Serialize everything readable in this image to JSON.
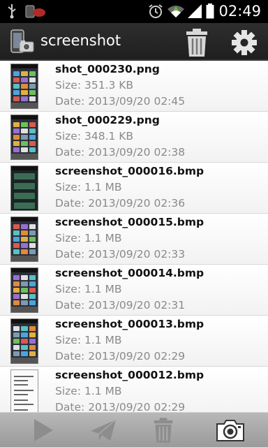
{
  "status_bar": {
    "time": "02:49",
    "icons": [
      "usb-icon",
      "app-notification-icon",
      "alarm-icon",
      "wifi-icon",
      "signal-icon",
      "battery-icon"
    ]
  },
  "action_bar": {
    "title": "screenshot",
    "icons": [
      "app-icon",
      "trash-icon",
      "gear-icon"
    ]
  },
  "files": [
    {
      "name": "shot_000230.png",
      "size": "Size: 351.3 KB",
      "date": "Date: 2013/09/20 02:45",
      "thumb": "home"
    },
    {
      "name": "shot_000229.png",
      "size": "Size: 348.1 KB",
      "date": "Date: 2013/09/20 02:38",
      "thumb": "home"
    },
    {
      "name": "screenshot_000016.bmp",
      "size": "Size: 1.1 MB",
      "date": "Date: 2013/09/20 02:36",
      "thumb": "dark"
    },
    {
      "name": "screenshot_000015.bmp",
      "size": "Size: 1.1 MB",
      "date": "Date: 2013/09/20 02:33",
      "thumb": "home"
    },
    {
      "name": "screenshot_000014.bmp",
      "size": "Size: 1.1 MB",
      "date": "Date: 2013/09/20 02:31",
      "thumb": "home"
    },
    {
      "name": "screenshot_000013.bmp",
      "size": "Size: 1.1 MB",
      "date": "Date: 2013/09/20 02:29",
      "thumb": "home"
    },
    {
      "name": "screenshot_000012.bmp",
      "size": "Size: 1.1 MB",
      "date": "Date: 2013/09/20 02:29",
      "thumb": "doc"
    }
  ],
  "bottom_bar": {
    "icons": [
      "play-icon",
      "send-icon",
      "trash-icon",
      "camera-icon"
    ]
  },
  "colors": {
    "status_bar_bg": "#000000",
    "action_bar_bg": "#262626",
    "meta_text": "#8a8a8a",
    "bottom_bar_bg": "#a8a8a8",
    "wifi_accent": "#5cbf2a"
  }
}
